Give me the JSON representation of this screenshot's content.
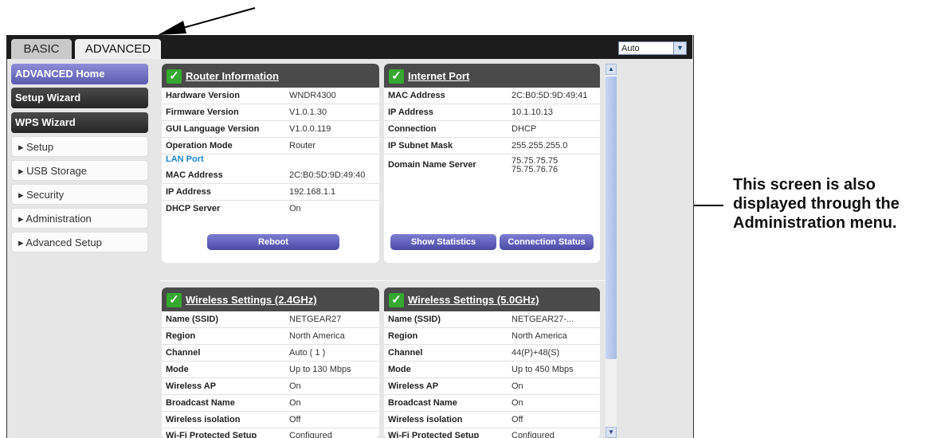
{
  "tabs": [
    {
      "label": "BASIC"
    },
    {
      "label": "ADVANCED"
    }
  ],
  "language_select": {
    "value": "Auto"
  },
  "sidebar": {
    "items": [
      {
        "label": "ADVANCED Home"
      },
      {
        "label": "Setup Wizard"
      },
      {
        "label": "WPS Wizard"
      },
      {
        "label": "▸ Setup"
      },
      {
        "label": "▸ USB Storage"
      },
      {
        "label": "▸ Security"
      },
      {
        "label": "▸ Administration"
      },
      {
        "label": "▸ Advanced Setup"
      }
    ]
  },
  "router_info": {
    "title": "Router Information",
    "rows": [
      {
        "label": "Hardware Version",
        "value": "WNDR4300"
      },
      {
        "label": "Firmware Version",
        "value": "V1.0.1.30"
      },
      {
        "label": "GUI Language Version",
        "value": "V1.0.0.119"
      },
      {
        "label": "Operation Mode",
        "value": "Router"
      }
    ],
    "lan_label": "LAN Port",
    "lan_rows": [
      {
        "label": "MAC Address",
        "value": "2C:B0:5D:9D:49:40"
      },
      {
        "label": "IP Address",
        "value": "192.168.1.1"
      },
      {
        "label": "DHCP Server",
        "value": "On"
      }
    ],
    "reboot_label": "Reboot"
  },
  "internet_port": {
    "title": "Internet Port",
    "rows": [
      {
        "label": "MAC Address",
        "value": "2C:B0:5D:9D:49:41"
      },
      {
        "label": "IP Address",
        "value": "10.1.10.13"
      },
      {
        "label": "Connection",
        "value": "DHCP"
      },
      {
        "label": "IP Subnet Mask",
        "value": "255.255.255.0"
      }
    ],
    "dns_label": "Domain Name Server",
    "dns_values": [
      "75.75.75.75",
      "75.75.76.76"
    ],
    "show_statistics_label": "Show Statistics",
    "connection_status_label": "Connection Status"
  },
  "wireless_24": {
    "title": "Wireless Settings (2.4GHz)",
    "rows": [
      {
        "label": "Name (SSID)",
        "value": "NETGEAR27"
      },
      {
        "label": "Region",
        "value": "North America"
      },
      {
        "label": "Channel",
        "value": "Auto ( 1 )"
      },
      {
        "label": "Mode",
        "value": "Up to 130 Mbps"
      },
      {
        "label": "Wireless AP",
        "value": "On"
      },
      {
        "label": "Broadcast Name",
        "value": "On"
      },
      {
        "label": "Wireless isolation",
        "value": "Off"
      },
      {
        "label": "Wi-Fi Protected Setup",
        "value": "Configured"
      }
    ]
  },
  "wireless_50": {
    "title": "Wireless Settings (5.0GHz)",
    "rows": [
      {
        "label": "Name (SSID)",
        "value": "NETGEAR27-..."
      },
      {
        "label": "Region",
        "value": "North America"
      },
      {
        "label": "Channel",
        "value": "44(P)+48(S)"
      },
      {
        "label": "Mode",
        "value": "Up to 450 Mbps"
      },
      {
        "label": "Wireless AP",
        "value": "On"
      },
      {
        "label": "Broadcast Name",
        "value": "On"
      },
      {
        "label": "Wireless isolation",
        "value": "Off"
      },
      {
        "label": "Wi-Fi Protected Setup",
        "value": "Configured"
      }
    ]
  },
  "caption": "This screen is also displayed through the Administration menu."
}
